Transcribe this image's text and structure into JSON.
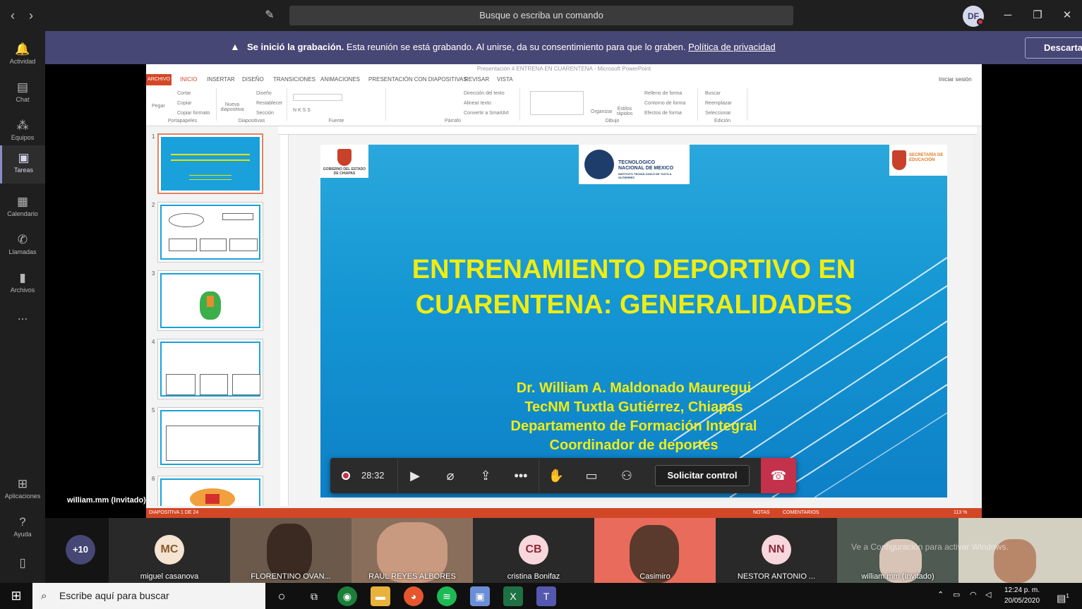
{
  "titlebar": {
    "search_placeholder": "Busque o escriba un comando",
    "user_initials": "DF"
  },
  "rail": {
    "items": [
      {
        "label": "Actividad",
        "icon": "bell-icon"
      },
      {
        "label": "Chat",
        "icon": "chat-icon"
      },
      {
        "label": "Equipos",
        "icon": "teams-icon"
      },
      {
        "label": "Tareas",
        "icon": "tasks-icon"
      },
      {
        "label": "Calendario",
        "icon": "calendar-icon"
      },
      {
        "label": "Llamadas",
        "icon": "phone-icon"
      },
      {
        "label": "Archivos",
        "icon": "files-icon"
      }
    ],
    "more": "...",
    "apps": "Aplicaciones",
    "help": "Ayuda"
  },
  "banner": {
    "bold": "Se inició la grabación.",
    "text": " Esta reunión se está grabando. Al unirse, da su consentimiento para que lo graben. ",
    "link": "Política de privacidad",
    "dismiss": "Descartar"
  },
  "presenter_label": "william.mm (Invitado)",
  "ppt": {
    "window_title": "Presentación 4 ENTRENA EN  CUARENTENA - Microsoft PowerPoint",
    "signin": "Iniciar sesión",
    "menu": [
      "ARCHIVO",
      "INICIO",
      "INSERTAR",
      "DISEÑO",
      "TRANSICIONES",
      "ANIMACIONES",
      "PRESENTACIÓN CON DIAPOSITIVAS",
      "REVISAR",
      "VISTA"
    ],
    "ribbon": {
      "portapapeles": "Portapapeles",
      "pegar": "Pegar",
      "cortar": "Cortar",
      "copiar": "Copiar",
      "copiar_formato": "Copiar formato",
      "nueva": "Nueva diapositiva",
      "diseno": "Diseño",
      "restablecer": "Restablecer",
      "seccion": "Sección",
      "diapositivas": "Diapositivas",
      "fuente": "Fuente",
      "parrafo": "Párrafo",
      "direccion": "Dirección del texto",
      "alinear": "Alinear texto",
      "smartart": "Convertir a SmartArt",
      "dibujo": "Dibujo",
      "organizar": "Organizar",
      "estilos": "Estilos rápidos",
      "relleno": "Relleno de forma",
      "contorno": "Contorno de forma",
      "efectos": "Efectos de forma",
      "buscar": "Buscar",
      "reemplazar": "Reemplazar",
      "seleccionar": "Seleccionar",
      "edicion": "Edición"
    },
    "thumbs": [
      "1",
      "2",
      "3",
      "4",
      "5",
      "6"
    ],
    "status_left": "DIAPOSITIVA 1 DE 24",
    "status_notes": "NOTAS",
    "status_comments": "COMENTARIOS",
    "zoom": "113 %"
  },
  "slide": {
    "title_line1": "ENTRENAMIENTO DEPORTIVO EN",
    "title_line2": "CUARENTENA: GENERALIDADES",
    "sub_line1": "Dr. William A. Maldonado Mauregui",
    "sub_line2": "TecNM Tuxtla Gutiérrez, Chiapas",
    "sub_line3": "Departamento de Formación Integral",
    "sub_line4": "Coordinador de deportes",
    "logo_left": "GOBIERNO DEL ESTADO DE CHIAPAS",
    "logo_center_1": "TECNOLOGICO",
    "logo_center_2": "NACIONAL DE MEXICO",
    "logo_center_3": "INSTITUTO TECNOLOGICO DE TUXTLA GUTIERREZ",
    "logo_right": "SECRETARÍA DE EDUCACIÓN"
  },
  "controls": {
    "timer": "28:32",
    "request": "Solicitar control"
  },
  "participants": {
    "more": "+10",
    "tiles": [
      {
        "initials": "MC",
        "name": "miguel casanova"
      },
      {
        "initials": "",
        "name": "FLORENTINO OVAN..."
      },
      {
        "initials": "",
        "name": "RAUL REYES ALBORES"
      },
      {
        "initials": "CB",
        "name": "cristina Bonifaz"
      },
      {
        "initials": "",
        "name": "Casimiro"
      },
      {
        "initials": "NN",
        "name": "NESTOR ANTONIO ..."
      },
      {
        "initials": "",
        "name": "william.mm (Invitado)"
      }
    ],
    "watermark": "Ve a Configuración para activar Windows."
  },
  "taskbar": {
    "search": "Escribe aquí para buscar",
    "time": "12:24 p. m.",
    "date": "20/05/2020",
    "notif": "1"
  },
  "colors": {
    "teams_purple": "#464775",
    "record_red": "#c4314b",
    "slide_yellow": "#f1ec12",
    "ppt_orange": "#d24726"
  }
}
